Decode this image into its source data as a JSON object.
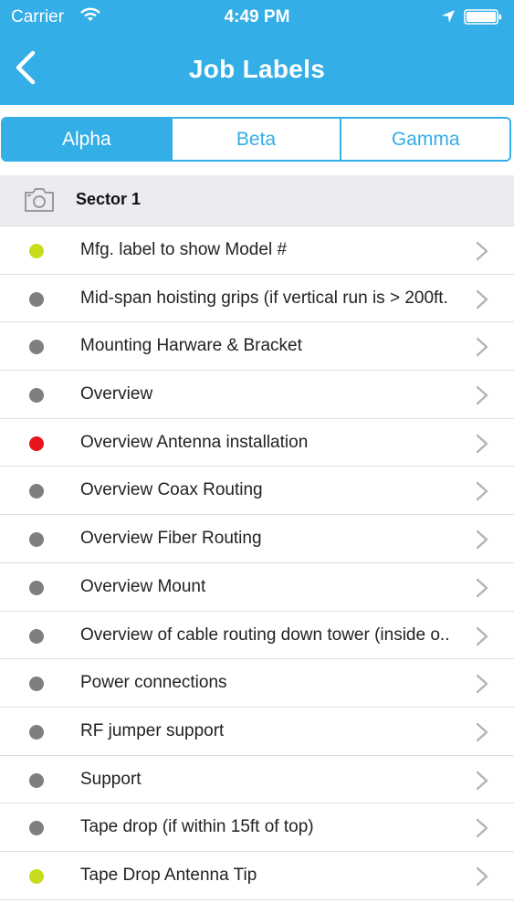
{
  "status_bar": {
    "carrier": "Carrier",
    "time": "4:49 PM"
  },
  "nav": {
    "title": "Job Labels",
    "back_icon": "chevron-left-icon"
  },
  "segments": [
    {
      "label": "Alpha",
      "selected": true
    },
    {
      "label": "Beta",
      "selected": false
    },
    {
      "label": "Gamma",
      "selected": false
    }
  ],
  "section": {
    "title": "Sector 1",
    "icon": "camera-icon"
  },
  "colors": {
    "accent": "#34aee6",
    "status_yellow": "#c8dc1e",
    "status_red": "#e8141e",
    "status_gray": "#7f7f7f"
  },
  "items": [
    {
      "label": "Mfg. label to show Model #",
      "status": "yellow"
    },
    {
      "label": "Mid-span hoisting grips (if vertical run is > 200ft.",
      "status": "gray"
    },
    {
      "label": "Mounting Harware & Bracket",
      "status": "gray"
    },
    {
      "label": "Overview",
      "status": "gray"
    },
    {
      "label": "Overview Antenna installation",
      "status": "red"
    },
    {
      "label": "Overview Coax Routing",
      "status": "gray"
    },
    {
      "label": "Overview Fiber Routing",
      "status": "gray"
    },
    {
      "label": "Overview Mount",
      "status": "gray"
    },
    {
      "label": "Overview of cable routing down tower (inside o..",
      "status": "gray"
    },
    {
      "label": "Power connections",
      "status": "gray"
    },
    {
      "label": "RF jumper support",
      "status": "gray"
    },
    {
      "label": "Support",
      "status": "gray"
    },
    {
      "label": "Tape drop (if within 15ft of top)",
      "status": "gray"
    },
    {
      "label": "Tape Drop Antenna Tip",
      "status": "yellow"
    }
  ]
}
